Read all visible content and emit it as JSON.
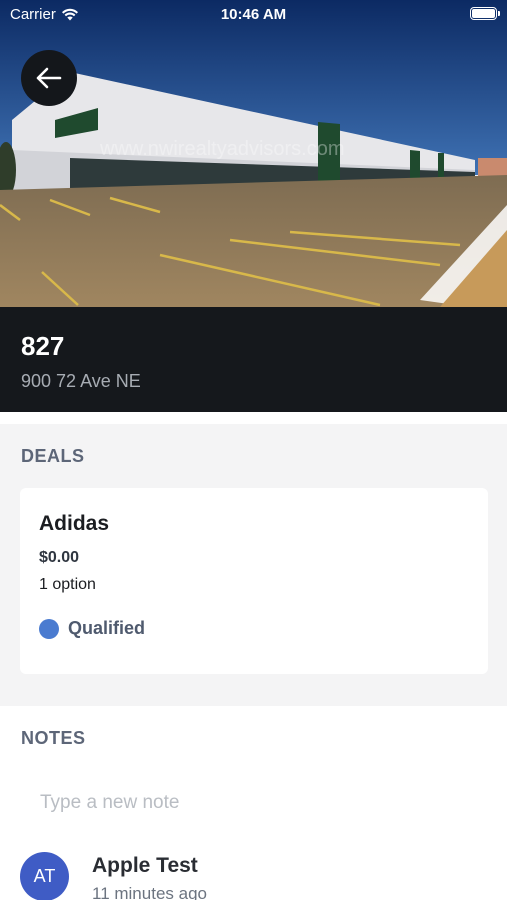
{
  "status_bar": {
    "carrier": "Carrier",
    "time": "10:46 AM",
    "wifi_icon": "wifi-icon",
    "battery_icon": "battery-icon"
  },
  "hero": {
    "image_subject": "industrial warehouse building with parking lot",
    "watermark": "www.nwirealtyadvisors.com",
    "back_icon": "arrow-left-icon"
  },
  "property": {
    "name": "827",
    "address": "900 72 Ave NE"
  },
  "deals": {
    "heading": "DEALS",
    "items": [
      {
        "name": "Adidas",
        "amount": "$0.00",
        "options": "1 option",
        "status": "Qualified",
        "status_color": "#4a7bd0"
      }
    ]
  },
  "notes": {
    "heading": "NOTES",
    "input_value": "",
    "input_placeholder": "Type a new note",
    "items": [
      {
        "initials": "AT",
        "author": "Apple Test",
        "timestamp": "11 minutes ago",
        "avatar_color": "#3f5cc5"
      }
    ]
  },
  "colors": {
    "title_bar_bg": "#15181c",
    "section_bg": "#f4f4f5",
    "heading_color": "#5d6678"
  }
}
